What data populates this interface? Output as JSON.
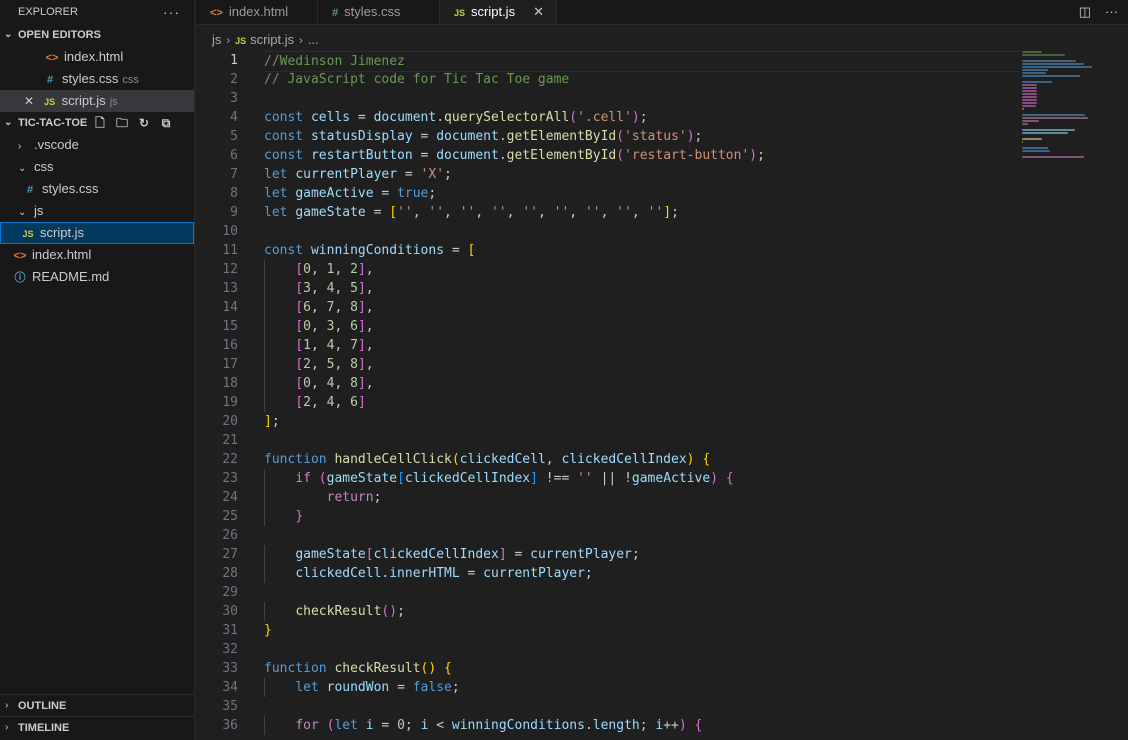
{
  "explorer": {
    "title": "EXPLORER",
    "more": "···",
    "open_editors_title": "OPEN EDITORS",
    "open_editors": [
      {
        "icon": "<>",
        "name": "index.html",
        "sub": ""
      },
      {
        "icon": "#",
        "name": "styles.css",
        "sub": "css"
      },
      {
        "icon": "JS",
        "name": "script.js",
        "sub": "js"
      }
    ],
    "project_title": "TIC-TAC-TOE",
    "tree": [
      {
        "label": ".vscode"
      },
      {
        "label": "css"
      },
      {
        "label": "styles.css"
      },
      {
        "label": "js"
      },
      {
        "label": "script.js"
      },
      {
        "label": "index.html"
      },
      {
        "label": "README.md"
      }
    ],
    "outline": "OUTLINE",
    "timeline": "TIMELINE"
  },
  "tabs": [
    {
      "icon": "<>",
      "label": "index.html"
    },
    {
      "icon": "#",
      "label": "styles.css"
    },
    {
      "icon": "JS",
      "label": "script.js",
      "close": "✕"
    }
  ],
  "breadcrumb": {
    "folder": "js",
    "file_icon": "JS",
    "file": "script.js",
    "rest": "..."
  },
  "colors": {
    "keyword": "#569cd6",
    "control": "#c586c0",
    "variable": "#9cdcfe",
    "function": "#dcdcaa",
    "string": "#ce9178",
    "number": "#b5cea8",
    "comment": "#6a9955",
    "bracket1": "#ffd700",
    "bracket2": "#da70d6",
    "bracket3": "#179fff",
    "text": "#cccccc"
  },
  "code": [
    [
      [
        "comment",
        "//Wedinson Jimenez"
      ]
    ],
    [
      [
        "comment",
        "// JavaScript code for Tic Tac Toe game"
      ]
    ],
    [],
    [
      [
        "keyword",
        "const "
      ],
      [
        "variable",
        "cells"
      ],
      [
        "text",
        " = "
      ],
      [
        "variable",
        "document"
      ],
      [
        "text",
        "."
      ],
      [
        "function",
        "querySelectorAll"
      ],
      [
        "bracket2",
        "("
      ],
      [
        "string",
        "'.cell'"
      ],
      [
        "bracket2",
        ")"
      ],
      [
        "text",
        ";"
      ]
    ],
    [
      [
        "keyword",
        "const "
      ],
      [
        "variable",
        "statusDisplay"
      ],
      [
        "text",
        " = "
      ],
      [
        "variable",
        "document"
      ],
      [
        "text",
        "."
      ],
      [
        "function",
        "getElementById"
      ],
      [
        "bracket2",
        "("
      ],
      [
        "string",
        "'status'"
      ],
      [
        "bracket2",
        ")"
      ],
      [
        "text",
        ";"
      ]
    ],
    [
      [
        "keyword",
        "const "
      ],
      [
        "variable",
        "restartButton"
      ],
      [
        "text",
        " = "
      ],
      [
        "variable",
        "document"
      ],
      [
        "text",
        "."
      ],
      [
        "function",
        "getElementById"
      ],
      [
        "bracket2",
        "("
      ],
      [
        "string",
        "'restart-button'"
      ],
      [
        "bracket2",
        ")"
      ],
      [
        "text",
        ";"
      ]
    ],
    [
      [
        "keyword",
        "let "
      ],
      [
        "variable",
        "currentPlayer"
      ],
      [
        "text",
        " = "
      ],
      [
        "string",
        "'X'"
      ],
      [
        "text",
        ";"
      ]
    ],
    [
      [
        "keyword",
        "let "
      ],
      [
        "variable",
        "gameActive"
      ],
      [
        "text",
        " = "
      ],
      [
        "keyword",
        "true"
      ],
      [
        "text",
        ";"
      ]
    ],
    [
      [
        "keyword",
        "let "
      ],
      [
        "variable",
        "gameState"
      ],
      [
        "text",
        " = "
      ],
      [
        "bracket1",
        "["
      ],
      [
        "string",
        "''"
      ],
      [
        "text",
        ", "
      ],
      [
        "string",
        "''"
      ],
      [
        "text",
        ", "
      ],
      [
        "string",
        "''"
      ],
      [
        "text",
        ", "
      ],
      [
        "string",
        "''"
      ],
      [
        "text",
        ", "
      ],
      [
        "string",
        "''"
      ],
      [
        "text",
        ", "
      ],
      [
        "string",
        "''"
      ],
      [
        "text",
        ", "
      ],
      [
        "string",
        "''"
      ],
      [
        "text",
        ", "
      ],
      [
        "string",
        "''"
      ],
      [
        "text",
        ", "
      ],
      [
        "string",
        "''"
      ],
      [
        "bracket1",
        "]"
      ],
      [
        "text",
        ";"
      ]
    ],
    [],
    [
      [
        "keyword",
        "const "
      ],
      [
        "variable",
        "winningConditions"
      ],
      [
        "text",
        " = "
      ],
      [
        "bracket1",
        "["
      ]
    ],
    [
      [
        "text",
        "    "
      ],
      [
        "bracket2",
        "["
      ],
      [
        "number",
        "0"
      ],
      [
        "text",
        ", "
      ],
      [
        "number",
        "1"
      ],
      [
        "text",
        ", "
      ],
      [
        "number",
        "2"
      ],
      [
        "bracket2",
        "]"
      ],
      [
        "text",
        ","
      ]
    ],
    [
      [
        "text",
        "    "
      ],
      [
        "bracket2",
        "["
      ],
      [
        "number",
        "3"
      ],
      [
        "text",
        ", "
      ],
      [
        "number",
        "4"
      ],
      [
        "text",
        ", "
      ],
      [
        "number",
        "5"
      ],
      [
        "bracket2",
        "]"
      ],
      [
        "text",
        ","
      ]
    ],
    [
      [
        "text",
        "    "
      ],
      [
        "bracket2",
        "["
      ],
      [
        "number",
        "6"
      ],
      [
        "text",
        ", "
      ],
      [
        "number",
        "7"
      ],
      [
        "text",
        ", "
      ],
      [
        "number",
        "8"
      ],
      [
        "bracket2",
        "]"
      ],
      [
        "text",
        ","
      ]
    ],
    [
      [
        "text",
        "    "
      ],
      [
        "bracket2",
        "["
      ],
      [
        "number",
        "0"
      ],
      [
        "text",
        ", "
      ],
      [
        "number",
        "3"
      ],
      [
        "text",
        ", "
      ],
      [
        "number",
        "6"
      ],
      [
        "bracket2",
        "]"
      ],
      [
        "text",
        ","
      ]
    ],
    [
      [
        "text",
        "    "
      ],
      [
        "bracket2",
        "["
      ],
      [
        "number",
        "1"
      ],
      [
        "text",
        ", "
      ],
      [
        "number",
        "4"
      ],
      [
        "text",
        ", "
      ],
      [
        "number",
        "7"
      ],
      [
        "bracket2",
        "]"
      ],
      [
        "text",
        ","
      ]
    ],
    [
      [
        "text",
        "    "
      ],
      [
        "bracket2",
        "["
      ],
      [
        "number",
        "2"
      ],
      [
        "text",
        ", "
      ],
      [
        "number",
        "5"
      ],
      [
        "text",
        ", "
      ],
      [
        "number",
        "8"
      ],
      [
        "bracket2",
        "]"
      ],
      [
        "text",
        ","
      ]
    ],
    [
      [
        "text",
        "    "
      ],
      [
        "bracket2",
        "["
      ],
      [
        "number",
        "0"
      ],
      [
        "text",
        ", "
      ],
      [
        "number",
        "4"
      ],
      [
        "text",
        ", "
      ],
      [
        "number",
        "8"
      ],
      [
        "bracket2",
        "]"
      ],
      [
        "text",
        ","
      ]
    ],
    [
      [
        "text",
        "    "
      ],
      [
        "bracket2",
        "["
      ],
      [
        "number",
        "2"
      ],
      [
        "text",
        ", "
      ],
      [
        "number",
        "4"
      ],
      [
        "text",
        ", "
      ],
      [
        "number",
        "6"
      ],
      [
        "bracket2",
        "]"
      ]
    ],
    [
      [
        "bracket1",
        "]"
      ],
      [
        "text",
        ";"
      ]
    ],
    [],
    [
      [
        "keyword",
        "function "
      ],
      [
        "function",
        "handleCellClick"
      ],
      [
        "bracket1",
        "("
      ],
      [
        "variable",
        "clickedCell"
      ],
      [
        "text",
        ", "
      ],
      [
        "variable",
        "clickedCellIndex"
      ],
      [
        "bracket1",
        ")"
      ],
      [
        "text",
        " "
      ],
      [
        "bracket1",
        "{"
      ]
    ],
    [
      [
        "text",
        "    "
      ],
      [
        "control",
        "if "
      ],
      [
        "bracket2",
        "("
      ],
      [
        "variable",
        "gameState"
      ],
      [
        "bracket3",
        "["
      ],
      [
        "variable",
        "clickedCellIndex"
      ],
      [
        "bracket3",
        "]"
      ],
      [
        "text",
        " !== "
      ],
      [
        "string",
        "''"
      ],
      [
        "text",
        " || !"
      ],
      [
        "variable",
        "gameActive"
      ],
      [
        "bracket2",
        ")"
      ],
      [
        "text",
        " "
      ],
      [
        "bracket2",
        "{"
      ]
    ],
    [
      [
        "text",
        "        "
      ],
      [
        "control",
        "return"
      ],
      [
        "text",
        ";"
      ]
    ],
    [
      [
        "text",
        "    "
      ],
      [
        "bracket2",
        "}"
      ]
    ],
    [],
    [
      [
        "text",
        "    "
      ],
      [
        "variable",
        "gameState"
      ],
      [
        "bracket2",
        "["
      ],
      [
        "variable",
        "clickedCellIndex"
      ],
      [
        "bracket2",
        "]"
      ],
      [
        "text",
        " = "
      ],
      [
        "variable",
        "currentPlayer"
      ],
      [
        "text",
        ";"
      ]
    ],
    [
      [
        "text",
        "    "
      ],
      [
        "variable",
        "clickedCell"
      ],
      [
        "text",
        "."
      ],
      [
        "variable",
        "innerHTML"
      ],
      [
        "text",
        " = "
      ],
      [
        "variable",
        "currentPlayer"
      ],
      [
        "text",
        ";"
      ]
    ],
    [],
    [
      [
        "text",
        "    "
      ],
      [
        "function",
        "checkResult"
      ],
      [
        "bracket2",
        "()"
      ],
      [
        "text",
        ";"
      ]
    ],
    [
      [
        "bracket1",
        "}"
      ]
    ],
    [],
    [
      [
        "keyword",
        "function "
      ],
      [
        "function",
        "checkResult"
      ],
      [
        "bracket1",
        "()"
      ],
      [
        "text",
        " "
      ],
      [
        "bracket1",
        "{"
      ]
    ],
    [
      [
        "text",
        "    "
      ],
      [
        "keyword",
        "let "
      ],
      [
        "variable",
        "roundWon"
      ],
      [
        "text",
        " = "
      ],
      [
        "keyword",
        "false"
      ],
      [
        "text",
        ";"
      ]
    ],
    [],
    [
      [
        "text",
        "    "
      ],
      [
        "control",
        "for "
      ],
      [
        "bracket2",
        "("
      ],
      [
        "keyword",
        "let "
      ],
      [
        "variable",
        "i"
      ],
      [
        "text",
        " = "
      ],
      [
        "number",
        "0"
      ],
      [
        "text",
        "; "
      ],
      [
        "variable",
        "i"
      ],
      [
        "text",
        " < "
      ],
      [
        "variable",
        "winningConditions"
      ],
      [
        "text",
        "."
      ],
      [
        "variable",
        "length"
      ],
      [
        "text",
        "; "
      ],
      [
        "variable",
        "i"
      ],
      [
        "text",
        "++"
      ],
      [
        "bracket2",
        ")"
      ],
      [
        "text",
        " "
      ],
      [
        "bracket2",
        "{"
      ]
    ]
  ]
}
